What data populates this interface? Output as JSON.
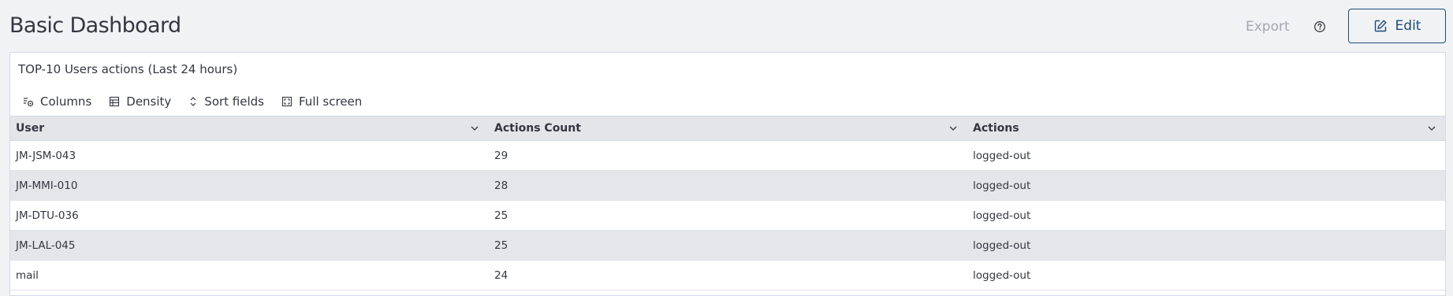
{
  "header": {
    "title": "Basic Dashboard",
    "export_label": "Export",
    "edit_label": "Edit"
  },
  "panel": {
    "title": "TOP-10 Users actions (Last 24 hours)",
    "toolbar": {
      "columns_label": "Columns",
      "density_label": "Density",
      "sort_label": "Sort fields",
      "fullscreen_label": "Full screen"
    },
    "table": {
      "columns": [
        "User",
        "Actions Count",
        "Actions"
      ],
      "rows": [
        [
          "JM-JSM-043",
          "29",
          "logged-out"
        ],
        [
          "JM-MMI-010",
          "28",
          "logged-out"
        ],
        [
          "JM-DTU-036",
          "25",
          "logged-out"
        ],
        [
          "JM-LAL-045",
          "25",
          "logged-out"
        ],
        [
          "mail",
          "24",
          "logged-out"
        ]
      ]
    }
  },
  "colors": {
    "page_bg": "#f1f2f4",
    "accent": "#1b4b78",
    "muted_text": "#a2a7b0",
    "header_bg": "#e3e5e9",
    "alt_row_bg": "#e5e6e9"
  },
  "icons": [
    "question-circle-icon",
    "edit-pencil-icon",
    "columns-gear-icon",
    "density-table-icon",
    "sort-arrows-icon",
    "fullscreen-icon",
    "chevron-down-icon"
  ]
}
